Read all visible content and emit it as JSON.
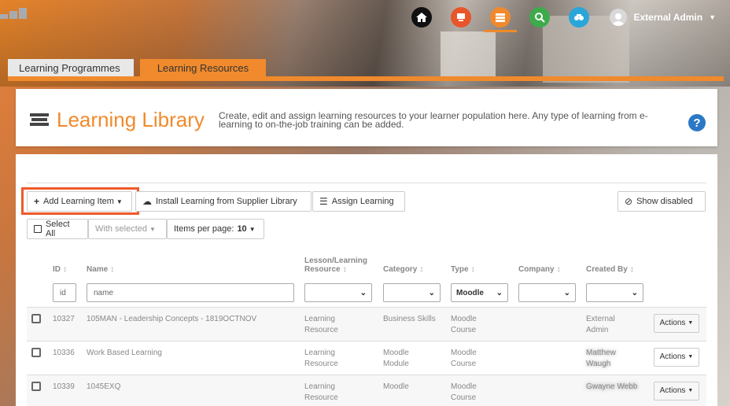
{
  "user": {
    "name": "External Admin"
  },
  "tabs": [
    {
      "label": "Learning Programmes",
      "active": false
    },
    {
      "label": "Learning Resources",
      "active": true
    }
  ],
  "header": {
    "title": "Learning Library",
    "description": "Create, edit and assign learning resources to your learner population here. Any type of learning from e-learning to on-the-job training can be added.",
    "help": "?"
  },
  "toolbar": {
    "add_label": "Add Learning Item",
    "install_label": "Install Learning from Supplier Library",
    "assign_label": "Assign Learning",
    "show_disabled_label": "Show disabled",
    "select_all_label": "Select All",
    "with_selected_label": "With selected",
    "items_per_page_label": "Items per page:",
    "items_per_page_value": "10"
  },
  "table": {
    "headers": {
      "id": "ID",
      "name": "Name",
      "lesson_a": "Lesson/Learning",
      "lesson_b": "Resource",
      "category": "Category",
      "type": "Type",
      "company": "Company",
      "created_by": "Created By"
    },
    "filters": {
      "id_placeholder": "id",
      "name_placeholder": "name",
      "type_value": "Moodle"
    },
    "rows": [
      {
        "id": "10327",
        "name": "105MAN - Leadership Concepts - 1819OCTNOV",
        "res_a": "Learning",
        "res_b": "Resource",
        "cat_a": "Business Skills",
        "cat_b": "",
        "type_a": "Moodle",
        "type_b": "Course",
        "created_a": "External",
        "created_b": "Admin",
        "actions": "Actions"
      },
      {
        "id": "10336",
        "name": "Work Based Learning",
        "res_a": "Learning",
        "res_b": "Resource",
        "cat_a": "Moodle",
        "cat_b": "Module",
        "type_a": "Moodle",
        "type_b": "Course",
        "created_a": "Matthew",
        "created_b": "Waugh",
        "actions": "Actions"
      },
      {
        "id": "10339",
        "name": "1045EXQ",
        "res_a": "Learning",
        "res_b": "Resource",
        "cat_a": "Moodle",
        "cat_b": "",
        "type_a": "Moodle",
        "type_b": "Course",
        "created_a": "Gwayne Webb",
        "created_b": "",
        "actions": "Actions"
      }
    ]
  },
  "colors": {
    "accent": "#f08a2c",
    "highlight": "#ef5a2a",
    "help": "#2b78c5"
  }
}
